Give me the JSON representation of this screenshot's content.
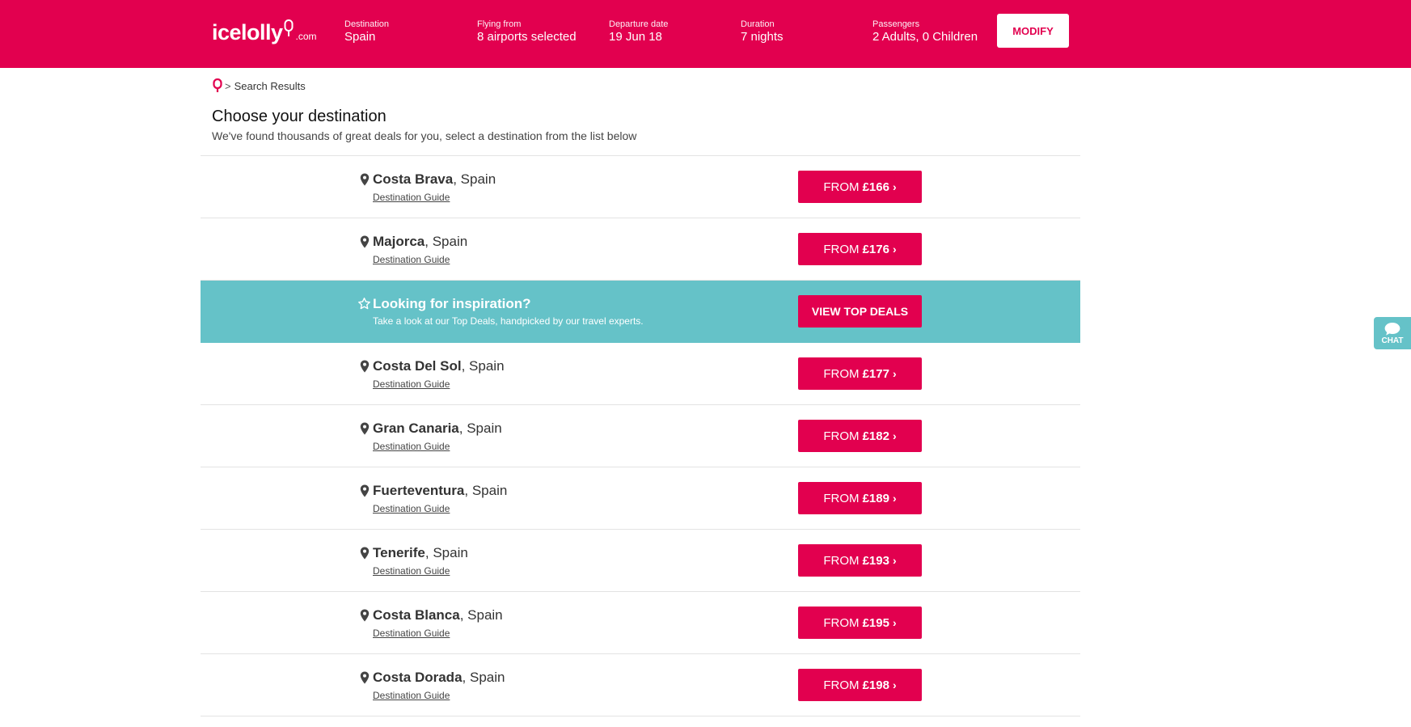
{
  "header": {
    "logo_text": "icelolly",
    "logo_tld": ".com",
    "fields": [
      {
        "label": "Destination",
        "value": "Spain"
      },
      {
        "label": "Flying from",
        "value": "8 airports selected"
      },
      {
        "label": "Departure date",
        "value": "19 Jun 18"
      },
      {
        "label": "Duration",
        "value": "7 nights"
      },
      {
        "label": "Passengers",
        "value": "2 Adults, 0 Children"
      }
    ],
    "modify_label": "MODIFY"
  },
  "breadcrumb": {
    "separator": ">",
    "current": "Search Results"
  },
  "page": {
    "title": "Choose your destination",
    "subtitle": "We've found thousands of great deals for you, select a destination from the list below"
  },
  "destinations": [
    {
      "name": "Costa Brava",
      "country": ", Spain",
      "guide": "Destination Guide",
      "from": "FROM",
      "price": "£166",
      "chevron": "›"
    },
    {
      "name": "Majorca",
      "country": ", Spain",
      "guide": "Destination Guide",
      "from": "FROM",
      "price": "£176",
      "chevron": "›"
    },
    {
      "name": "Costa Del Sol",
      "country": ", Spain",
      "guide": "Destination Guide",
      "from": "FROM",
      "price": "£177",
      "chevron": "›"
    },
    {
      "name": "Gran Canaria",
      "country": ", Spain",
      "guide": "Destination Guide",
      "from": "FROM",
      "price": "£182",
      "chevron": "›"
    },
    {
      "name": "Fuerteventura",
      "country": ", Spain",
      "guide": "Destination Guide",
      "from": "FROM",
      "price": "£189",
      "chevron": "›"
    },
    {
      "name": "Tenerife",
      "country": ", Spain",
      "guide": "Destination Guide",
      "from": "FROM",
      "price": "£193",
      "chevron": "›"
    },
    {
      "name": "Costa Blanca",
      "country": ", Spain",
      "guide": "Destination Guide",
      "from": "FROM",
      "price": "£195",
      "chevron": "›"
    },
    {
      "name": "Costa Dorada",
      "country": ", Spain",
      "guide": "Destination Guide",
      "from": "FROM",
      "price": "£198",
      "chevron": "›"
    }
  ],
  "promo": {
    "title": "Looking for inspiration?",
    "text": "Take a look at our Top Deals, handpicked by our travel experts.",
    "button_label": "VIEW TOP DEALS"
  },
  "chat": {
    "label": "CHAT"
  },
  "colors": {
    "brand": "#e2004f",
    "promo": "#65c2c8",
    "text": "#333333"
  },
  "icons": {
    "location": "map-pin-icon",
    "promo": "star-outline-icon",
    "breadcrumb_home": "ice-lolly-icon",
    "chat": "speech-bubble-icon"
  }
}
